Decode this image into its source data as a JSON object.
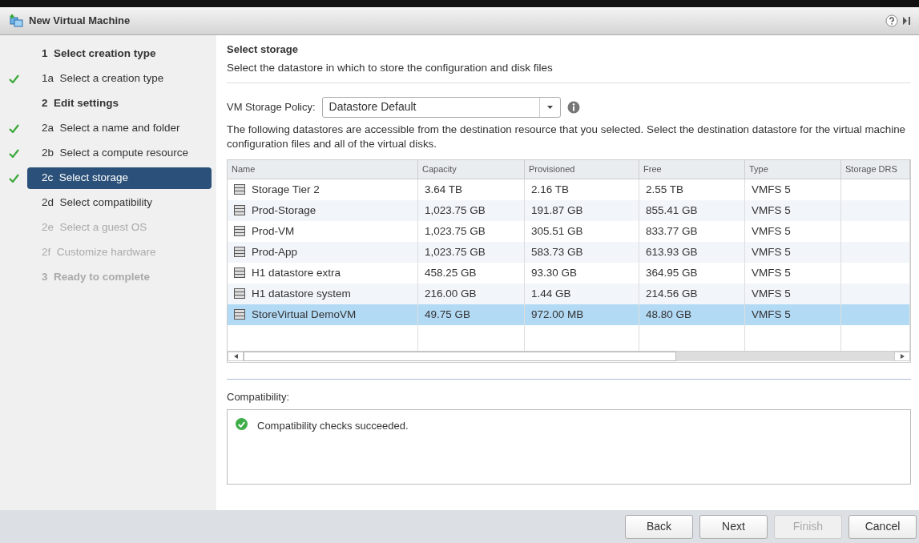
{
  "window": {
    "title": "New Virtual Machine"
  },
  "steps": [
    {
      "kind": "heading",
      "number": "1",
      "label": "Select creation type",
      "done": false,
      "selected": false,
      "disabled": false
    },
    {
      "kind": "sub",
      "number": "1a",
      "label": "Select a creation type",
      "done": true,
      "selected": false,
      "disabled": false
    },
    {
      "kind": "heading",
      "number": "2",
      "label": "Edit settings",
      "done": false,
      "selected": false,
      "disabled": false
    },
    {
      "kind": "sub",
      "number": "2a",
      "label": "Select a name and folder",
      "done": true,
      "selected": false,
      "disabled": false
    },
    {
      "kind": "sub",
      "number": "2b",
      "label": "Select a compute resource",
      "done": true,
      "selected": false,
      "disabled": false
    },
    {
      "kind": "sub",
      "number": "2c",
      "label": "Select storage",
      "done": true,
      "selected": true,
      "disabled": false
    },
    {
      "kind": "sub",
      "number": "2d",
      "label": "Select compatibility",
      "done": false,
      "selected": false,
      "disabled": false
    },
    {
      "kind": "sub",
      "number": "2e",
      "label": "Select a guest OS",
      "done": false,
      "selected": false,
      "disabled": true
    },
    {
      "kind": "sub",
      "number": "2f",
      "label": "Customize hardware",
      "done": false,
      "selected": false,
      "disabled": true
    },
    {
      "kind": "heading",
      "number": "3",
      "label": "Ready to complete",
      "done": false,
      "selected": false,
      "disabled": true
    }
  ],
  "page": {
    "title": "Select storage",
    "subtitle": "Select the datastore in which to store the configuration and disk files"
  },
  "policy": {
    "label": "VM Storage Policy:",
    "value": "Datastore Default"
  },
  "description": "The following datastores are accessible from the destination resource that you selected. Select the destination datastore for the virtual machine configuration files and all of the virtual disks.",
  "table": {
    "columns": [
      "Name",
      "Capacity",
      "Provisioned",
      "Free",
      "Type",
      "Storage DRS"
    ],
    "rows": [
      {
        "cells": [
          "Storage Tier 2",
          "3.64 TB",
          "2.16 TB",
          "2.55 TB",
          "VMFS 5"
        ],
        "selected": false
      },
      {
        "cells": [
          "Prod-Storage",
          "1,023.75 GB",
          "191.87 GB",
          "855.41 GB",
          "VMFS 5"
        ],
        "selected": false
      },
      {
        "cells": [
          "Prod-VM",
          "1,023.75 GB",
          "305.51 GB",
          "833.77 GB",
          "VMFS 5"
        ],
        "selected": false
      },
      {
        "cells": [
          "Prod-App",
          "1,023.75 GB",
          "583.73 GB",
          "613.93 GB",
          "VMFS 5"
        ],
        "selected": false
      },
      {
        "cells": [
          "H1 datastore extra",
          "458.25 GB",
          "93.30 GB",
          "364.95 GB",
          "VMFS 5"
        ],
        "selected": false
      },
      {
        "cells": [
          "H1 datastore system",
          "216.00 GB",
          "1.44 GB",
          "214.56 GB",
          "VMFS 5"
        ],
        "selected": false
      },
      {
        "cells": [
          "StoreVirtual DemoVM",
          "49.75 GB",
          "972.00 MB",
          "48.80 GB",
          "VMFS 5"
        ],
        "selected": true
      }
    ]
  },
  "compatibility": {
    "label": "Compatibility:",
    "message": "Compatibility checks succeeded."
  },
  "buttons": [
    {
      "label": "Back",
      "disabled": false
    },
    {
      "label": "Next",
      "disabled": false
    },
    {
      "label": "Finish",
      "disabled": true
    },
    {
      "label": "Cancel",
      "disabled": false
    }
  ]
}
